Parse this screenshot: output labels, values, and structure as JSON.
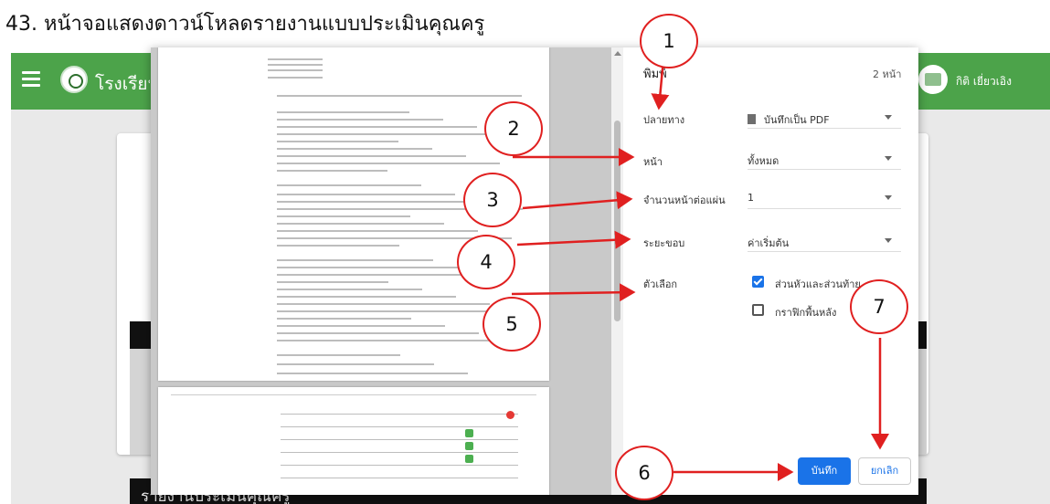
{
  "caption": "43. หน้าจอแสดงดาวน์โหลดรายงานแบบประเมินคุณครู",
  "app": {
    "school_name": "โรงเรียน",
    "username": "กิติ เยี่ยวเอิง",
    "report_heading": "รายงานประเมินคุณครู"
  },
  "print_dialog": {
    "title": "พิมพ์",
    "page_count": "2 หน้า",
    "fields": {
      "destination": {
        "label": "ปลายทาง",
        "value": "บันทึกเป็น PDF"
      },
      "pages": {
        "label": "หน้า",
        "value": "ทั้งหมด"
      },
      "pages_per_sheet": {
        "label": "จำนวนหน้าต่อแผ่น",
        "value": "1"
      },
      "margins": {
        "label": "ระยะขอบ",
        "value": "ค่าเริ่มต้น"
      },
      "options": {
        "label": "ตัวเลือก",
        "headers_footers": {
          "label": "ส่วนหัวและส่วนท้าย",
          "checked": true
        },
        "background_graphics": {
          "label": "กราฟิกพื้นหลัง",
          "checked": false
        }
      }
    },
    "save_button": "บันทึก",
    "cancel_button": "ยกเลิก",
    "accent_color": "#1a73e8"
  },
  "callouts": [
    "1",
    "2",
    "3",
    "4",
    "5",
    "6",
    "7"
  ],
  "colors": {
    "header_green": "#4ca34a",
    "callout_red": "#e02020"
  }
}
